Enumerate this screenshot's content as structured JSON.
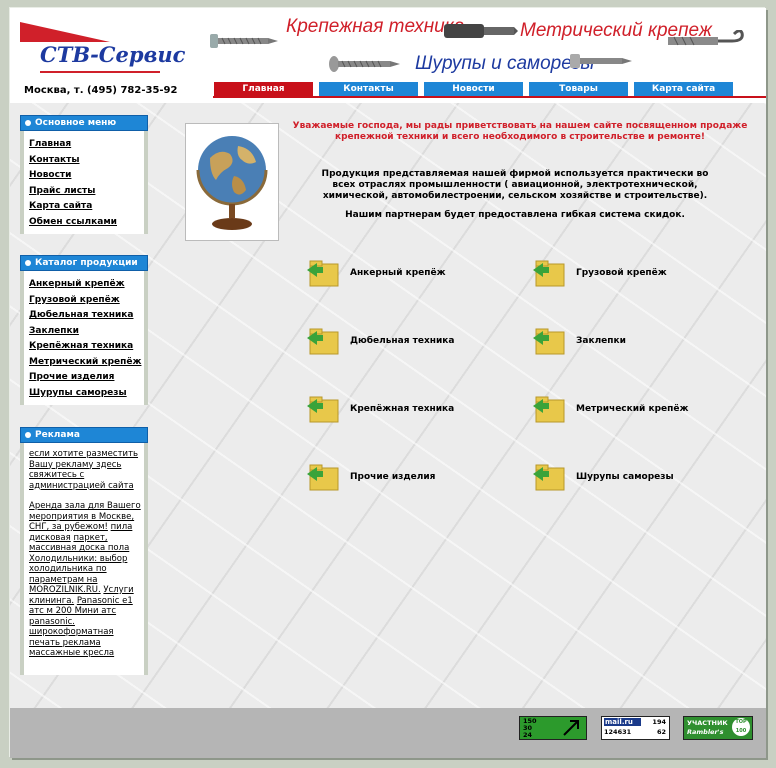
{
  "header": {
    "logo_text": "СТВ-Сервис",
    "phone": "Москва, т. (495) 782-35-92",
    "slogans": [
      "Крепежная техника",
      "Метрический крепеж",
      "Шурупы и саморезы"
    ]
  },
  "nav": [
    {
      "label": "Главная",
      "active": true
    },
    {
      "label": "Контакты",
      "active": false
    },
    {
      "label": "Новости",
      "active": false
    },
    {
      "label": "Товары",
      "active": false
    },
    {
      "label": "Карта сайта",
      "active": false
    }
  ],
  "sidebar": {
    "main_menu": {
      "title": "Основное меню",
      "items": [
        "Главная",
        "Контакты",
        "Новости",
        "Прайс листы",
        "Карта сайта",
        "Обмен ссылками"
      ]
    },
    "catalog": {
      "title": "Каталог продукции",
      "items": [
        "Анкерный крепёж",
        "Грузовой крепёж",
        "Дюбельная техника",
        "Заклепки",
        "Крепёжная техника",
        "Метрический крепёж",
        "Прочие изделия",
        "Шурупы саморезы"
      ]
    },
    "ads": {
      "title": "Реклама",
      "invite": "если хотите разместить Вашу рекламу здесь свяжитесь с администрацией сайта",
      "text1": "Аренда зала для Вашего мероприятия в Москве, СНГ, за рубежом!",
      "text2": "пила дисковая",
      "text3": "паркет, массивная доска пола",
      "text4": "Холодильники: выбор холодильника по параметрам на MOROZILNIK.RU.",
      "text5": "Услуги клининга.",
      "text6": "Panasonic e1 атс м 200 Мини атс panasonic.",
      "text7": "широкоформатная печать реклама",
      "text8": "массажные кресла"
    }
  },
  "main": {
    "intro_red": "Уважаемые господа, мы рады приветствовать на нашем сайте посвященном продаже крепежной техники и всего необходимого в строительстве и ремонте!",
    "intro_black": "Продукция представляемая нашей фирмой используется практически во всех отраслях промышленности ( авиационной, электротехнической, химической, автомобилестроении, сельском хозяйстве и строительстве).",
    "intro_partner": "Нашим партнерам будет предоставлена гибкая система скидок.",
    "categories": [
      "Анкерный крепёж",
      "Грузовой крепёж",
      "Дюбельная техника",
      "Заклепки",
      "Крепёжная техника",
      "Метрический крепёж",
      "Прочие изделия",
      "Шурупы саморезы"
    ]
  },
  "footer": {
    "counter1": {
      "lines": [
        "150",
        "30",
        "24"
      ]
    },
    "counter2": {
      "brand": "mail.ru",
      "value": "124631",
      "top": "194",
      "bottom": "62"
    },
    "counter3": {
      "line1": "УЧАСТНИК",
      "line2": "Rambler's",
      "badge": "TOP 100"
    }
  },
  "colors": {
    "accent_blue": "#1e86d6",
    "accent_red": "#c8101a",
    "logo_blue": "#1d3aa0"
  }
}
